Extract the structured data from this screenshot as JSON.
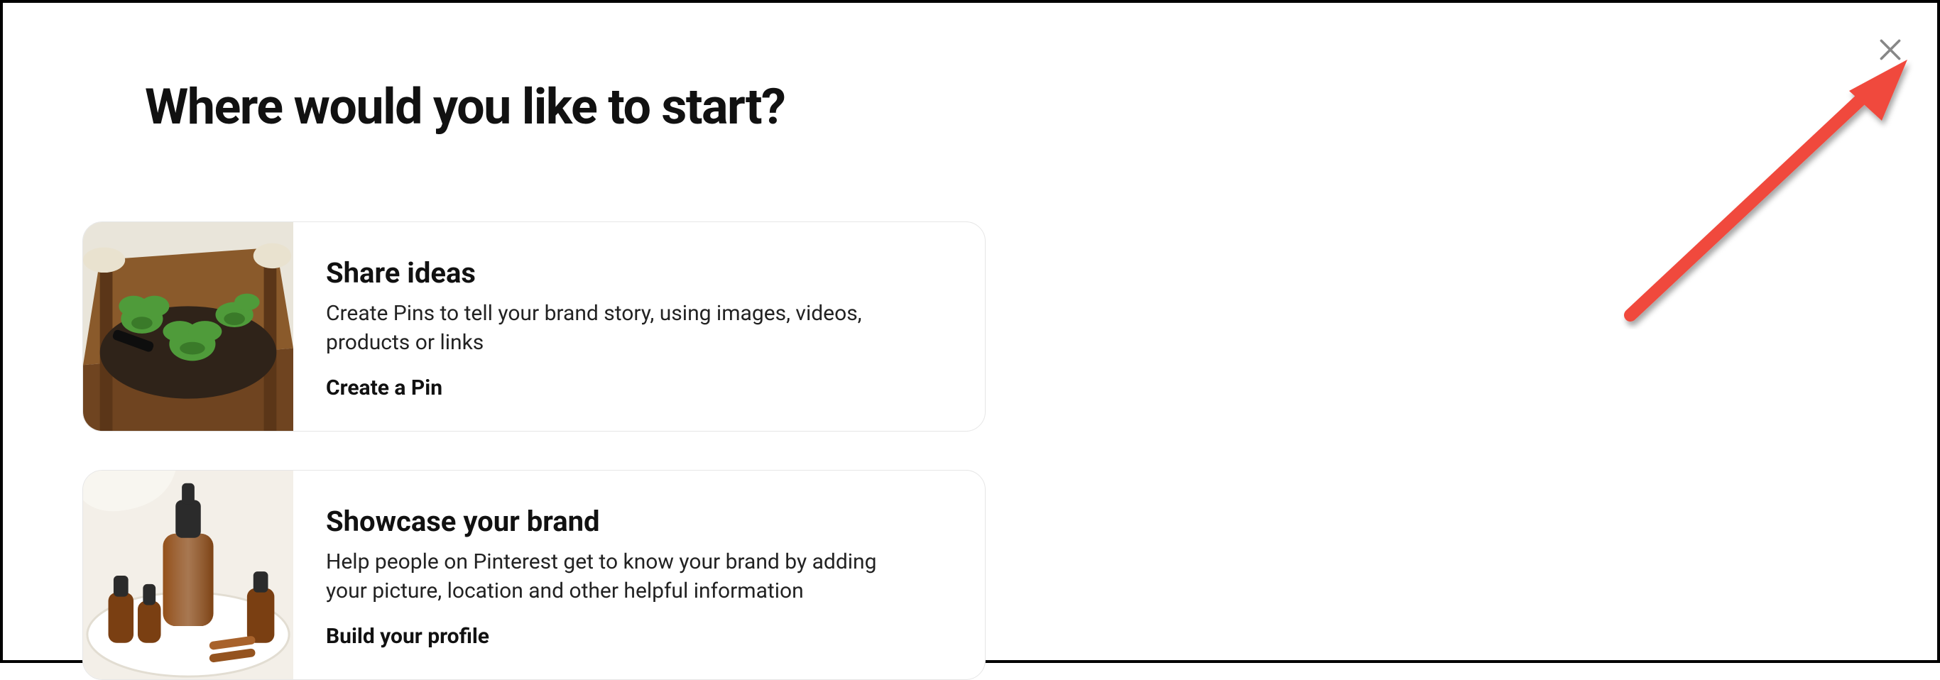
{
  "modal": {
    "title": "Where would you like to start?"
  },
  "cards": [
    {
      "title": "Share ideas",
      "description": "Create Pins to tell your brand story, using images, videos, products or links",
      "cta": "Create a Pin"
    },
    {
      "title": "Showcase your brand",
      "description": "Help people on Pinterest get to know your brand by adding your picture, location and other helpful information",
      "cta": "Build your profile"
    }
  ]
}
